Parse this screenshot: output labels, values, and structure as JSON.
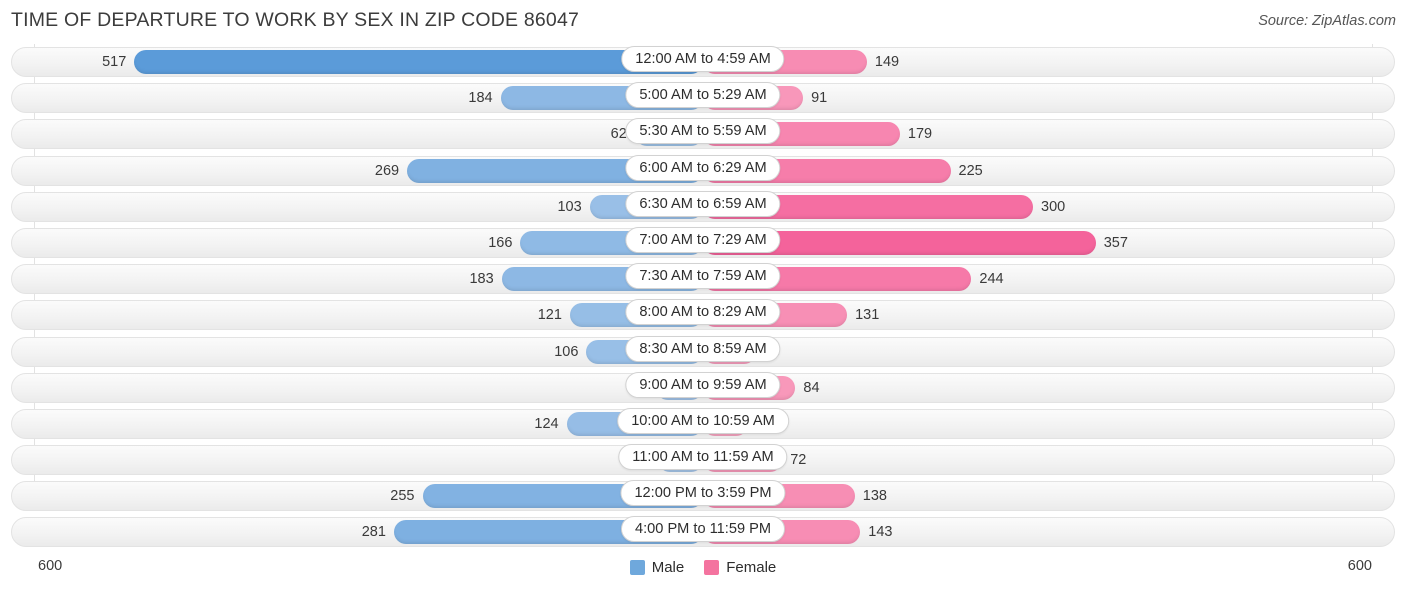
{
  "header": {
    "title": "TIME OF DEPARTURE TO WORK BY SEX IN ZIP CODE 86047",
    "source": "Source: ZipAtlas.com"
  },
  "legend": {
    "male_label": "Male",
    "female_label": "Female",
    "male_color": "#6fa8dc",
    "female_color": "#f4739f"
  },
  "axis": {
    "left_label": "600",
    "right_label": "600"
  },
  "chart_data": {
    "type": "bar",
    "title": "TIME OF DEPARTURE TO WORK BY SEX IN ZIP CODE 86047",
    "subtitle": "",
    "orientation": "horizontal-diverging",
    "xlabel": "",
    "ylabel": "",
    "xlim": [
      600,
      600
    ],
    "axis_max": 600,
    "grid": true,
    "legend_position": "bottom-center",
    "categories": [
      "12:00 AM to 4:59 AM",
      "5:00 AM to 5:29 AM",
      "5:30 AM to 5:59 AM",
      "6:00 AM to 6:29 AM",
      "6:30 AM to 6:59 AM",
      "7:00 AM to 7:29 AM",
      "7:30 AM to 7:59 AM",
      "8:00 AM to 8:29 AM",
      "8:30 AM to 8:59 AM",
      "9:00 AM to 9:59 AM",
      "10:00 AM to 10:59 AM",
      "11:00 AM to 11:59 AM",
      "12:00 PM to 3:59 PM",
      "4:00 PM to 11:59 PM"
    ],
    "series": [
      {
        "name": "Male",
        "color": "#6fa8dc",
        "side": "left",
        "values": [
          517,
          184,
          62,
          269,
          103,
          166,
          183,
          121,
          106,
          43,
          124,
          6,
          255,
          281
        ]
      },
      {
        "name": "Female",
        "color": "#f4739f",
        "side": "right",
        "values": [
          149,
          91,
          179,
          225,
          300,
          357,
          244,
          131,
          48,
          84,
          9,
          72,
          138,
          143
        ]
      }
    ]
  }
}
